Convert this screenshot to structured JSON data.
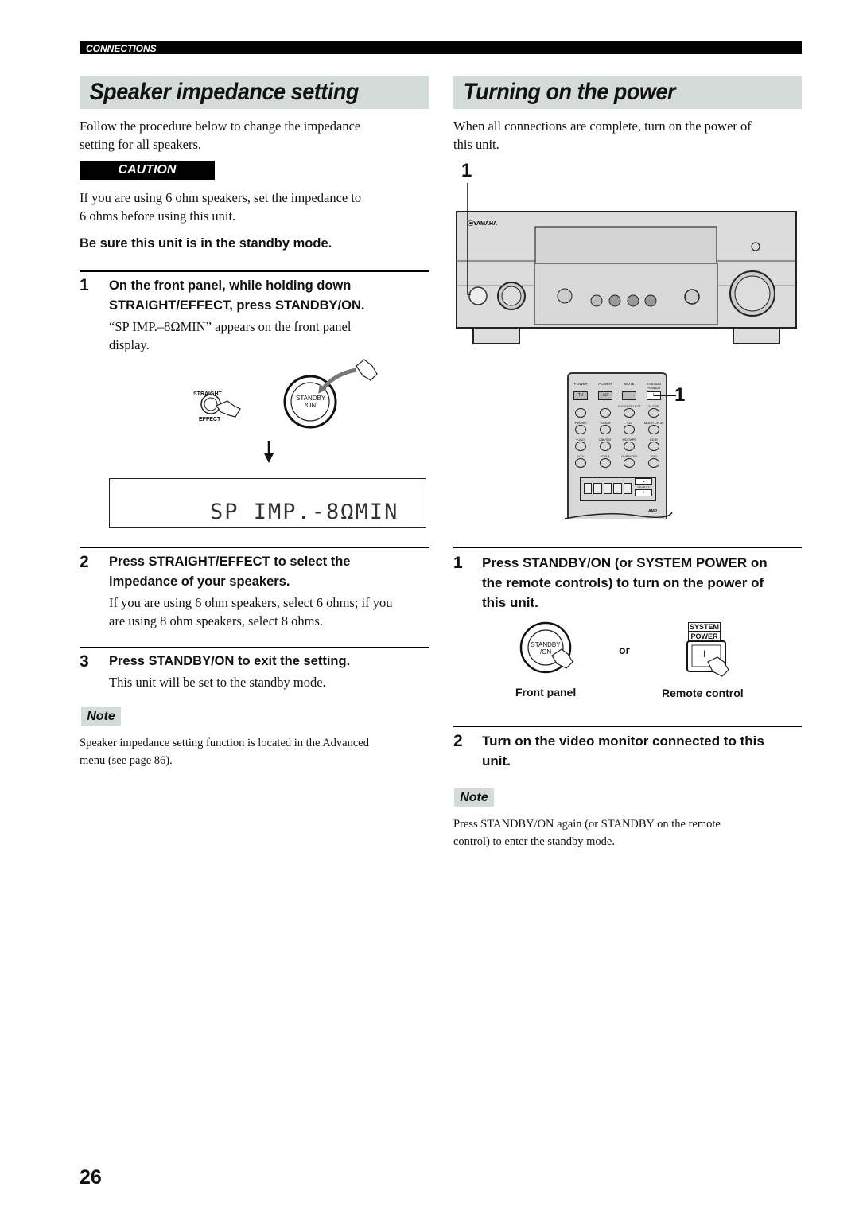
{
  "header": {
    "section": "CONNECTIONS"
  },
  "left": {
    "title": "Speaker impedance setting",
    "intro": [
      "Follow the procedure below to change the impedance",
      "setting for all speakers."
    ],
    "caution_label": "CAUTION",
    "caution_text": [
      "If you are using 6 ohm speakers, set the impedance to",
      "6 ohms before using this unit."
    ],
    "standby_note": "Be sure this unit is in the standby mode.",
    "steps": [
      {
        "num": "1",
        "heading": [
          "On the front panel, while holding down",
          "STRAIGHT/EFFECT, press STANDBY/ON."
        ],
        "text": [
          "“SP IMP.–8ΩMIN” appears on the front panel",
          "display."
        ]
      },
      {
        "num": "2",
        "heading": [
          "Press STRAIGHT/EFFECT to select the",
          "impedance of your speakers."
        ],
        "text": [
          "If you are using 6 ohm speakers, select 6 ohms; if you",
          "are using 8 ohm speakers, select 8 ohms."
        ]
      },
      {
        "num": "3",
        "heading": [
          "Press STANDBY/ON to exit the setting."
        ],
        "text": [
          "This unit will be set to the standby mode."
        ]
      }
    ],
    "figure": {
      "straight": "STRAIGHT",
      "effect": "EFFECT",
      "standby": "STANDBY",
      "on": "/ON",
      "display": "SP IMP.-8ΩMIN"
    },
    "note_label": "Note",
    "note_text": [
      "Speaker impedance setting function is located in the Advanced",
      "menu (see page 86)."
    ]
  },
  "right": {
    "title": "Turning on the power",
    "intro": [
      "When all connections are complete, turn on the power of",
      "this unit."
    ],
    "callout_1": "1",
    "callout_remote": "1",
    "receiver_logo": "YAMAHA",
    "remote": {
      "top_labels": [
        "POWER",
        "POWER",
        "MUTE",
        "SYSTEM POWER"
      ],
      "top_buttons": [
        "TV",
        "AV",
        "",
        "I"
      ],
      "rows": [
        [
          "",
          "",
          "AUDIO SELECT",
          "SLEEP"
        ],
        [
          "PHONO",
          "TUNER",
          "CD",
          "MULTI CH IN"
        ],
        [
          "V-AUX",
          "CBL/SAT",
          "MD/TAPE",
          "CD-R"
        ],
        [
          "DTV",
          "VCR 1",
          "DVR/VCR2",
          "DVD"
        ]
      ],
      "select": "SELECT",
      "amp": "AMP"
    },
    "steps": [
      {
        "num": "1",
        "heading": [
          "Press STANDBY/ON (or SYSTEM POWER on",
          "the remote controls) to turn on the power of",
          "this unit."
        ]
      },
      {
        "num": "2",
        "heading": [
          "Turn on the video monitor connected to this",
          "unit."
        ]
      }
    ],
    "figure": {
      "standby": "STANDBY",
      "on": "/ON",
      "or": "or",
      "system": "SYSTEM",
      "power": "POWER",
      "power_key": "I",
      "front_caption": "Front panel",
      "remote_caption": "Remote control"
    },
    "note_label": "Note",
    "note_text": [
      "Press STANDBY/ON again (or STANDBY on the remote",
      "control) to enter the standby mode."
    ]
  },
  "page_number": "26",
  "colors": {
    "title_bg": "#d3dcd8",
    "bar": "#000000"
  }
}
